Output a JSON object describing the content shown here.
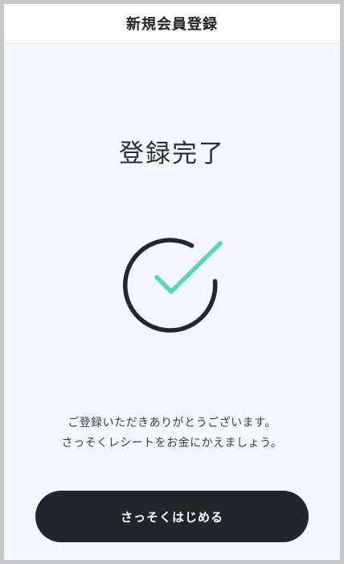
{
  "header": {
    "title": "新規会員登録"
  },
  "main": {
    "title": "登録完了",
    "icon": "circle-check-icon",
    "message_line1": "ご登録いただきありがとうございます。",
    "message_line2": "さっそくレシートをお金にかえましょう。"
  },
  "actions": {
    "start_label": "さっそくはじめる"
  },
  "colors": {
    "check_accent": "#5ad6b4",
    "circle_stroke": "#24272c",
    "button_bg": "#22262b",
    "page_bg": "#f4f8fc"
  }
}
